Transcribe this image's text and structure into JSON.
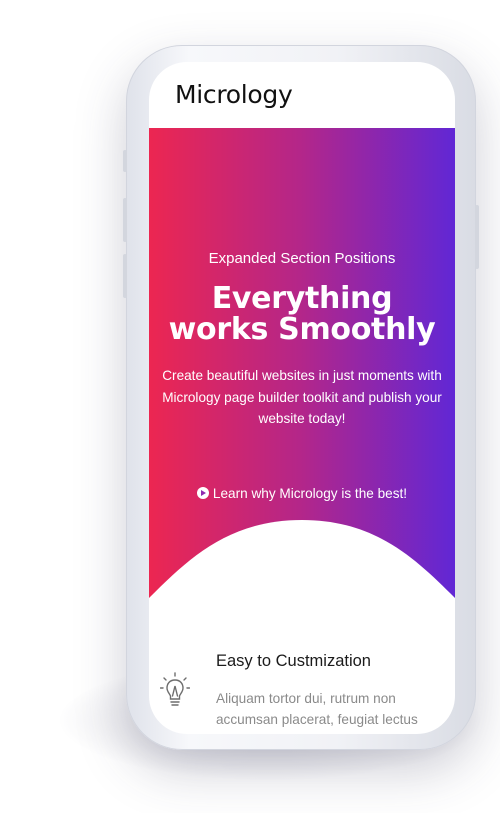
{
  "app": {
    "brand": "Micrology"
  },
  "hero": {
    "subtitle": "Expanded Section Positions",
    "title_line1": "Everything",
    "title_line2": "works Smoothly",
    "description": "Create beautiful websites in just moments with Micrology page builder toolkit and publish your website today!",
    "link_label": "Learn why Micrology is the best!",
    "link_icon": "play-circle-icon",
    "gradient_start": "#ec2651",
    "gradient_end": "#6127d5"
  },
  "feature": {
    "icon": "lightbulb-icon",
    "title": "Easy to Custmization",
    "description_line1": "Aliquam tortor dui, rutrum non",
    "description_line2": "accumsan placerat, feugiat lectus"
  }
}
